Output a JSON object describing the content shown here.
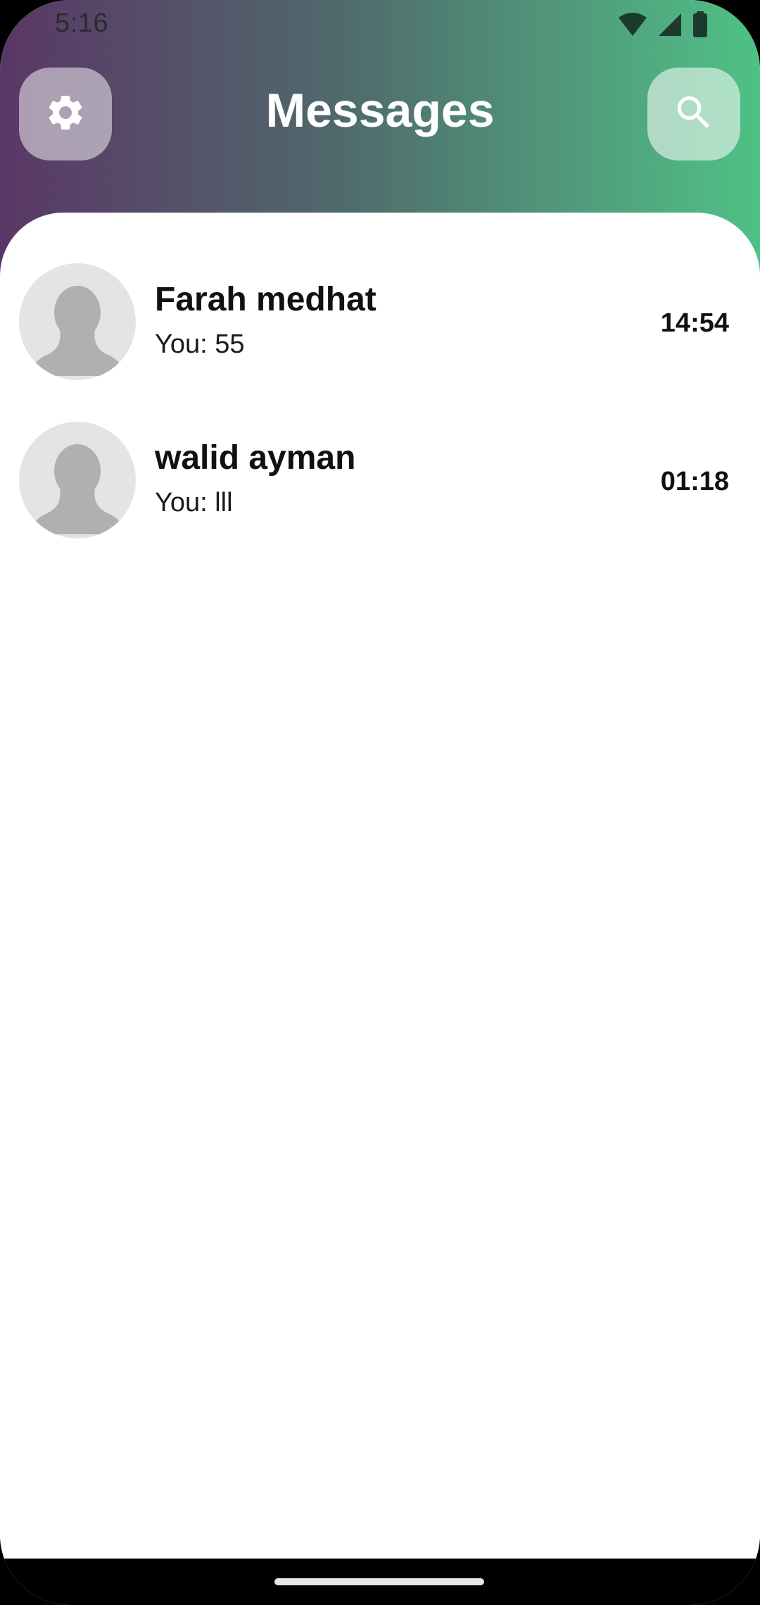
{
  "status_bar": {
    "time": "5:16",
    "icons": [
      "wifi-icon",
      "signal-icon",
      "battery-icon"
    ]
  },
  "header": {
    "title": "Messages",
    "settings_icon": "gear-icon",
    "search_icon": "search-icon"
  },
  "conversations": [
    {
      "name": "Farah medhat",
      "preview": "You: 55",
      "time": "14:54",
      "avatar_icon": "default-avatar-icon"
    },
    {
      "name": "walid ayman",
      "preview": "You: lll",
      "time": "01:18",
      "avatar_icon": "default-avatar-icon"
    }
  ],
  "colors": {
    "header_gradient_start": "#5a3766",
    "header_gradient_end": "#4fc185",
    "background": "#ffffff",
    "avatar_bg": "#e4e4e4",
    "avatar_silhouette": "#b0b0b0"
  }
}
